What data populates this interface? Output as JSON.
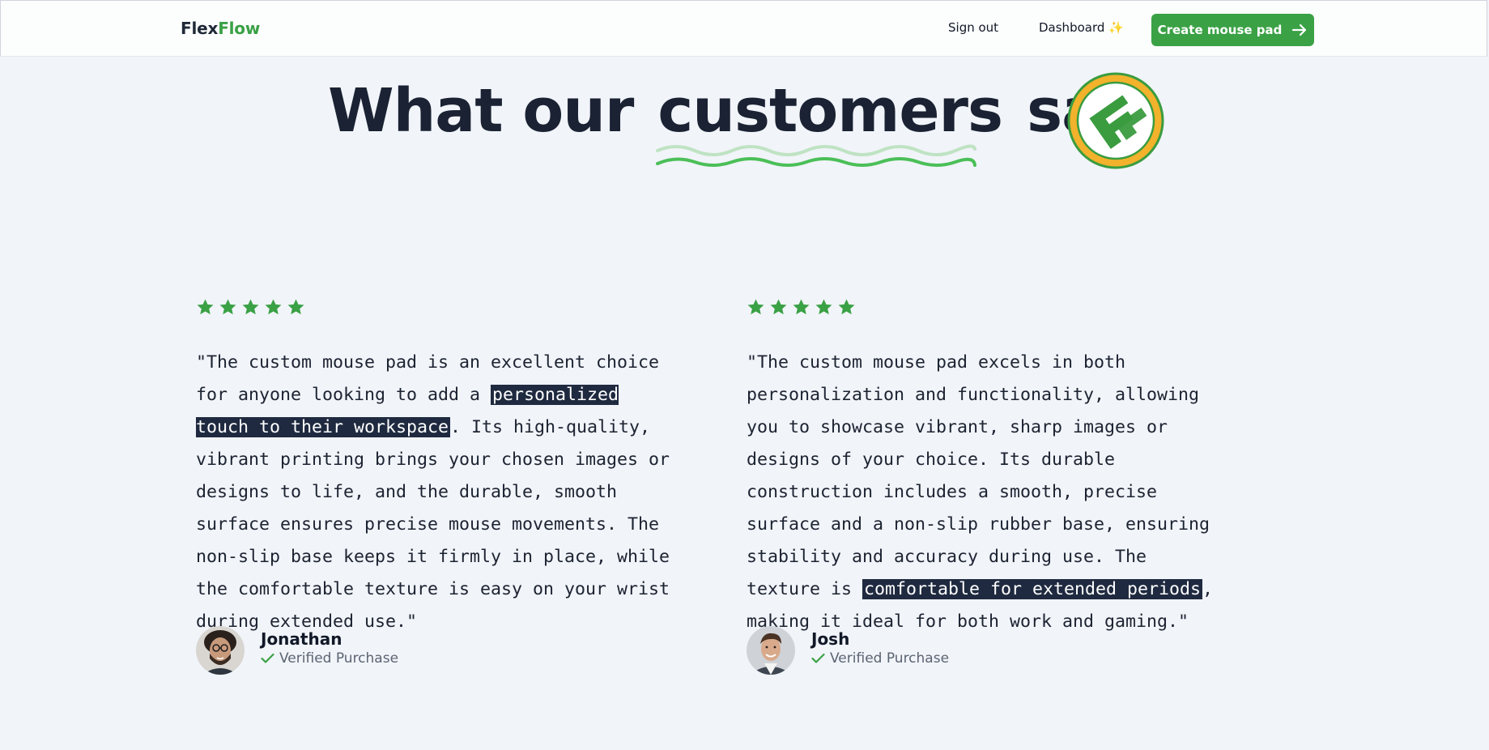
{
  "nav": {
    "logo_part1": "Flex",
    "logo_part2": "Flow",
    "sign_out": "Sign out",
    "dashboard": "Dashboard",
    "dashboard_icon": "sparkles-icon",
    "cta_label": "Create mouse pad",
    "cta_icon": "arrow-right-icon"
  },
  "heading": {
    "word1": "What our",
    "word2": "customers",
    "word3": "say",
    "badge_icon": "flexflow-logo-badge"
  },
  "colors": {
    "brand_green": "#3aa145",
    "highlight_bg": "#1f2a40",
    "page_bg": "#f1f4f9",
    "text_dark": "#1a2233",
    "badge_gold": "#f2b22c"
  },
  "reviews": [
    {
      "rating": 5,
      "quote_before": "\"The custom mouse pad is an excellent choice for anyone looking to add a ",
      "quote_highlight": "personalized touch to their workspace",
      "quote_after": ". Its high-quality, vibrant printing brings your chosen images or designs to life, and the durable, smooth surface ensures precise mouse movements. The non-slip base keeps it firmly in place, while the comfortable texture is easy on your wrist during extended use.\"",
      "name": "Jonathan",
      "verified": "Verified Purchase"
    },
    {
      "rating": 5,
      "quote_before": "\"The custom mouse pad excels in both personalization and functionality, allowing you to showcase vibrant, sharp images or designs of your choice. Its durable construction includes a smooth, precise surface and a non-slip rubber base, ensuring stability and accuracy during use. The texture is ",
      "quote_highlight": "comfortable for extended periods",
      "quote_after": ", making it ideal for both work and gaming.\"",
      "name": "Josh",
      "verified": "Verified Purchase"
    }
  ]
}
